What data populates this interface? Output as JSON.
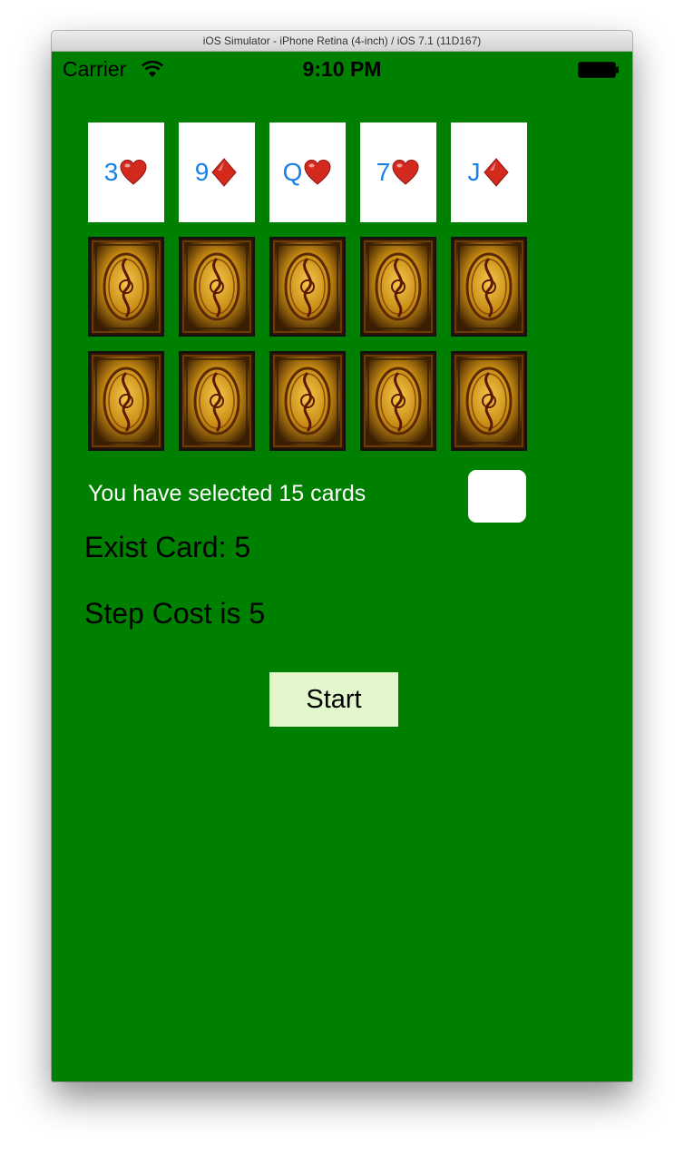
{
  "window": {
    "title": "iOS Simulator - iPhone Retina (4-inch) / iOS 7.1 (11D167)"
  },
  "status_bar": {
    "carrier": "Carrier",
    "time": "9:10 PM",
    "icons": [
      "wifi-icon",
      "battery-icon"
    ]
  },
  "cards": {
    "face_up": [
      {
        "rank": "3",
        "suit": "hearts"
      },
      {
        "rank": "9",
        "suit": "diamonds"
      },
      {
        "rank": "Q",
        "suit": "hearts"
      },
      {
        "rank": "7",
        "suit": "hearts"
      },
      {
        "rank": "J",
        "suit": "diamonds"
      }
    ],
    "face_down_rows": 2,
    "face_down_per_row": 5
  },
  "colors": {
    "table_green": "#008000",
    "rank_blue": "#1a7fe6",
    "suit_red": "#d42a1e",
    "start_button_bg": "#e3f7cc"
  },
  "info": {
    "selected_text": "You have selected 15 cards",
    "exist_card": "Exist Card: 5",
    "step_cost": "Step Cost is 5"
  },
  "controls": {
    "start_label": "Start"
  }
}
